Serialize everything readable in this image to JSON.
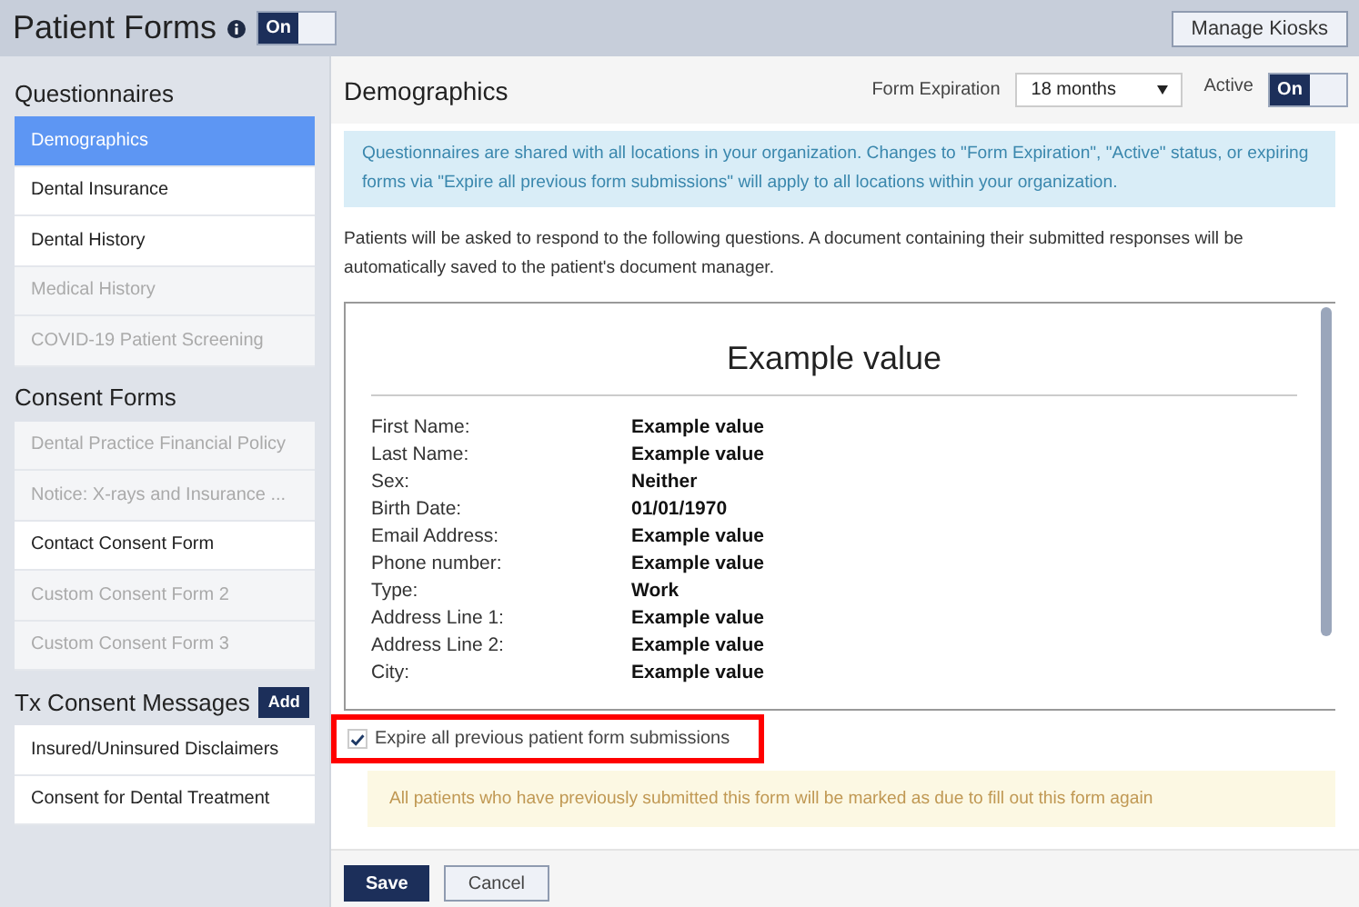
{
  "header": {
    "title": "Patient Forms",
    "toggle": {
      "label": "On",
      "on": true
    },
    "button": "Manage Kiosks"
  },
  "sidebar": {
    "sections": [
      {
        "title": "Questionnaires",
        "items": [
          {
            "label": "Demographics",
            "selected": true,
            "disabled": false
          },
          {
            "label": "Dental Insurance",
            "selected": false,
            "disabled": false
          },
          {
            "label": "Dental History",
            "selected": false,
            "disabled": false
          },
          {
            "label": "Medical History",
            "selected": false,
            "disabled": true
          },
          {
            "label": "COVID-19 Patient Screening",
            "selected": false,
            "disabled": true
          }
        ]
      },
      {
        "title": "Consent Forms",
        "items": [
          {
            "label": "Dental Practice Financial Policy",
            "selected": false,
            "disabled": true
          },
          {
            "label": "Notice: X-rays and Insurance ...",
            "selected": false,
            "disabled": true
          },
          {
            "label": "Contact Consent Form",
            "selected": false,
            "disabled": false
          },
          {
            "label": "Custom Consent Form 2",
            "selected": false,
            "disabled": true
          },
          {
            "label": "Custom Consent Form 3",
            "selected": false,
            "disabled": true
          }
        ]
      },
      {
        "title": "Tx Consent Messages",
        "button": "Add",
        "items": [
          {
            "label": "Insured/Uninsured Disclaimers",
            "selected": false,
            "disabled": false
          },
          {
            "label": "Consent for Dental Treatment",
            "selected": false,
            "disabled": false
          }
        ]
      }
    ]
  },
  "main": {
    "title": "Demographics",
    "expiration": {
      "label": "Form Expiration",
      "value": "18 months"
    },
    "active": {
      "label": "Active",
      "toggle": "On",
      "on": true
    },
    "info": "Questionnaires are shared with all locations in your organization. Changes to \"Form Expiration\", \"Active\" status, or expiring forms via \"Expire all previous form submissions\" will apply to all locations within your organization.",
    "intro": "Patients will be asked to respond to the following questions. A document containing their submitted responses will be automatically saved to the patient's document manager.",
    "preview": {
      "title": "Example value",
      "fields": [
        {
          "label": "First Name:",
          "value": "Example value"
        },
        {
          "label": "Last Name:",
          "value": "Example value"
        },
        {
          "label": "Sex:",
          "value": "Neither"
        },
        {
          "label": "Birth Date:",
          "value": "01/01/1970"
        },
        {
          "label": "Email Address:",
          "value": "Example value"
        },
        {
          "label": "Phone number:",
          "value": "Example value"
        },
        {
          "label": "Type:",
          "value": "Work"
        },
        {
          "label": "Address Line 1:",
          "value": "Example value"
        },
        {
          "label": "Address Line 2:",
          "value": "Example value"
        },
        {
          "label": "City:",
          "value": "Example value"
        }
      ]
    },
    "expire_checkbox": {
      "label": "Expire all previous patient form submissions",
      "checked": true,
      "highlighted": true
    },
    "warning": "All patients who have previously submitted this form will be marked as due to fill out this form again",
    "buttons": [
      {
        "label": "Save",
        "kind": "primary"
      },
      {
        "label": "Cancel",
        "kind": "secondary"
      }
    ]
  }
}
